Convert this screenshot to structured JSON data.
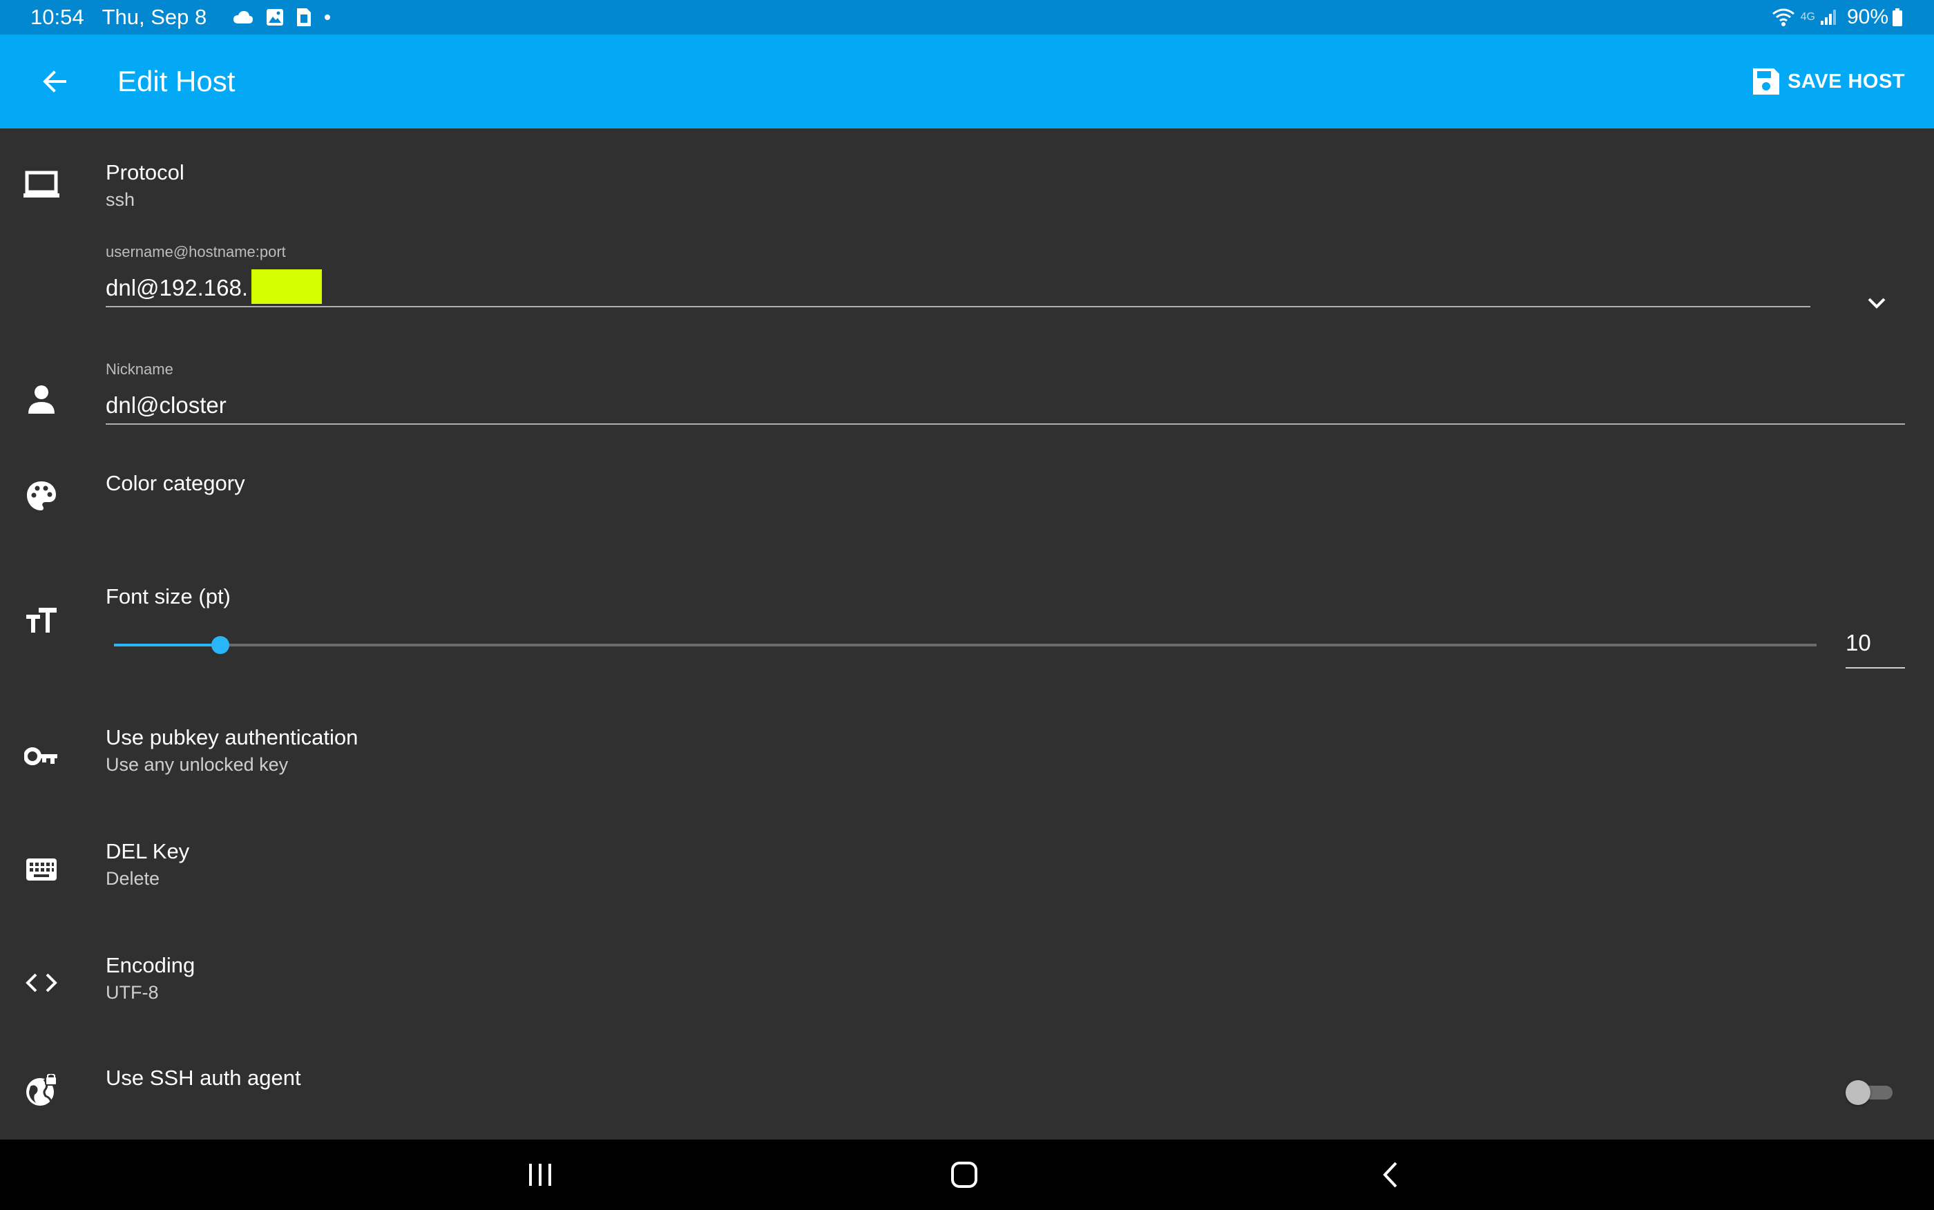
{
  "status_bar": {
    "time": "10:54",
    "date": "Thu, Sep 8",
    "notification_icons": [
      "cloud-icon",
      "image-icon",
      "sim-card-icon",
      "dot-icon"
    ],
    "network": "4G",
    "battery": "90%"
  },
  "app_bar": {
    "title": "Edit Host",
    "save_label": "SAVE HOST",
    "background": "#03a9f4"
  },
  "form": {
    "protocol": {
      "title": "Protocol",
      "value": "ssh"
    },
    "host": {
      "label": "username@hostname:port",
      "value": "dnl@192.168."
    },
    "nickname": {
      "label": "Nickname",
      "value": "dnl@closter"
    },
    "color_category": {
      "title": "Color category"
    },
    "font_size": {
      "title": "Font size (pt)",
      "value": "10",
      "slider_fraction": 0.0625
    },
    "pubkey": {
      "title": "Use pubkey authentication",
      "value": "Use any unlocked key"
    },
    "del_key": {
      "title": "DEL Key",
      "value": "Delete"
    },
    "encoding": {
      "title": "Encoding",
      "value": "UTF-8"
    },
    "ssh_agent": {
      "title": "Use SSH auth agent",
      "enabled": false
    }
  },
  "colors": {
    "accent": "#29b6f6",
    "background": "#303030",
    "status_bar": "#0288d1",
    "redaction": "#d4ff00"
  }
}
